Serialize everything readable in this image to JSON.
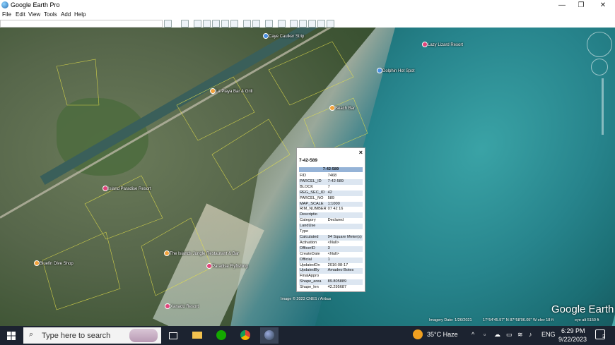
{
  "window": {
    "title": "Google Earth Pro",
    "controls": [
      "—",
      "❐",
      "✕"
    ]
  },
  "menu": [
    "File",
    "Edit",
    "View",
    "Tools",
    "Add",
    "Help"
  ],
  "map_places": [
    "La Playa Bar & Grill",
    "Caye Caulker Strip",
    "Lazy Lizard Resort",
    "Dolphin Hot Spot",
    "Beach Bar",
    "Island Paradise Resort",
    "The Islands Jungle Restaurant & Bar",
    "Bluefin Dive Shop",
    "Paradise Flyfishing",
    "Xanadu Resort"
  ],
  "popup": {
    "title": "7-42-589",
    "header": "7-42-589",
    "rows": [
      [
        "FID",
        "7468"
      ],
      [
        "PARCEL_ID",
        "7-42-589"
      ],
      [
        "BLOCK",
        "7"
      ],
      [
        "REG_SEC_ID",
        "42"
      ],
      [
        "PARCEL_NO",
        "589"
      ],
      [
        "MAP_SCALE",
        "1:1000"
      ],
      [
        "RIM_NUMBER",
        "07 42 16"
      ],
      [
        "Descriptio",
        ""
      ],
      [
        "Category",
        "Declared"
      ],
      [
        "LandUse",
        ""
      ],
      [
        "Type",
        ""
      ],
      [
        "Calculated",
        "94 Square Meter(s)"
      ],
      [
        "Activation",
        "<Null>"
      ],
      [
        "OfficerID",
        "3"
      ],
      [
        "CreateDate",
        "<Null>"
      ],
      [
        "Official",
        "1"
      ],
      [
        "UpdatedOn",
        "2016-08-17"
      ],
      [
        "UpdatedBy",
        "Amadeo Botes"
      ],
      [
        "FinalAppro",
        ""
      ],
      [
        "Shape_area",
        "89.805889"
      ],
      [
        "Shape_len",
        "42.295687"
      ]
    ]
  },
  "map_footer": {
    "imagery_credit": "Image © 2023 CNES / Airbus",
    "imagery_date": "Imagery Date: 1/26/2021",
    "coordinates": "17°54'45.97\" N   87°58'06.05\" W   elev   18 ft",
    "eye_alt": "eye alt  5150 ft",
    "brand": "Google Earth"
  },
  "taskbar": {
    "search_placeholder": "Type here to search",
    "apps": [
      "task-view",
      "file-explorer",
      "upwork",
      "chrome",
      "google-earth"
    ],
    "weather": "35°C  Haze",
    "language": "ENG",
    "time": "6:29 PM",
    "date": "9/22/2023",
    "notification_count": "3"
  }
}
